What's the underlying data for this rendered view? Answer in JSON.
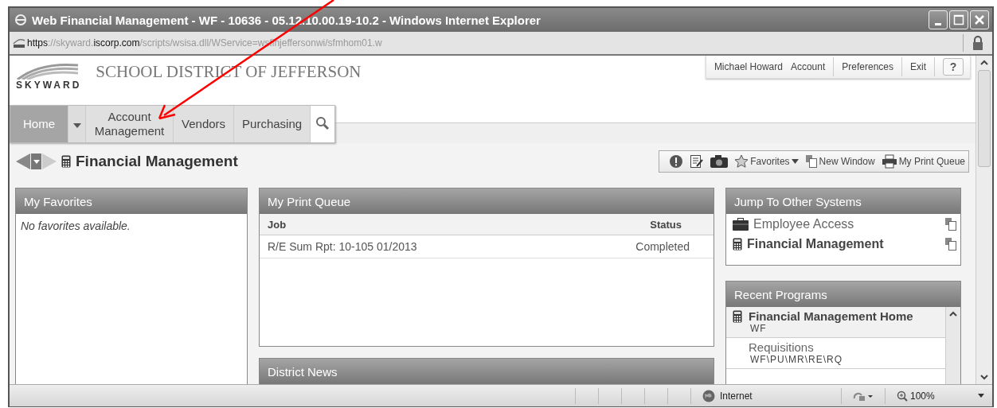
{
  "window": {
    "title": "Web Financial Management - WF - 10636 - 05.12.10.00.19-10.2 - Windows Internet Explorer"
  },
  "address_bar": {
    "url_parts": [
      {
        "text": "https",
        "emphasized": true
      },
      {
        "text": "://skyward.",
        "emphasized": false
      },
      {
        "text": "iscorp.com",
        "emphasized": true
      },
      {
        "text": "/scripts/wsisa.dll/WService=wsfinjeffersonwi/sfmhom01.w",
        "emphasized": false
      }
    ]
  },
  "header": {
    "logo": "SKYWARD",
    "district": "SCHOOL DISTRICT OF JEFFERSON",
    "user_menu": [
      "Michael Howard",
      "Account",
      "Preferences",
      "Exit"
    ],
    "help": "?"
  },
  "nav": [
    {
      "label": "Home",
      "selected": true
    },
    {
      "label": "Account Management",
      "selected": false
    },
    {
      "label": "Vendors",
      "selected": false
    },
    {
      "label": "Purchasing",
      "selected": false
    }
  ],
  "page_title": "Financial Management",
  "toolbar": [
    {
      "kind": "alert"
    },
    {
      "kind": "notes"
    },
    {
      "kind": "camera"
    },
    {
      "kind": "favorites",
      "label": "Favorites"
    },
    {
      "kind": "new-window",
      "label": "New Window"
    },
    {
      "kind": "print",
      "label": "My Print Queue"
    }
  ],
  "favorites_panel": {
    "title": "My Favorites",
    "empty_text": "No favorites available."
  },
  "print_queue": {
    "title": "My Print Queue",
    "columns": [
      "Job",
      "Status"
    ],
    "rows": [
      [
        "R/E Sum Rpt: 10-105 01/2013",
        "Completed"
      ]
    ]
  },
  "district_news": {
    "title": "District News"
  },
  "jump_systems": {
    "title": "Jump To Other Systems",
    "items": [
      {
        "label": "Employee Access",
        "kind": "briefcase",
        "current": false
      },
      {
        "label": "Financial Management",
        "kind": "calculator",
        "current": true
      }
    ]
  },
  "recent_programs": {
    "title": "Recent Programs",
    "items": [
      {
        "name": "Financial Management Home",
        "path": "WF",
        "kind": "calculator",
        "selected": true
      },
      {
        "name": "Requisitions",
        "path": "WF\\PU\\MR\\RE\\RQ",
        "kind": "plain",
        "selected": false
      }
    ]
  },
  "status_bar": {
    "zone": "Internet",
    "zoom": "100%"
  },
  "annotation": {
    "kind": "arrow"
  }
}
